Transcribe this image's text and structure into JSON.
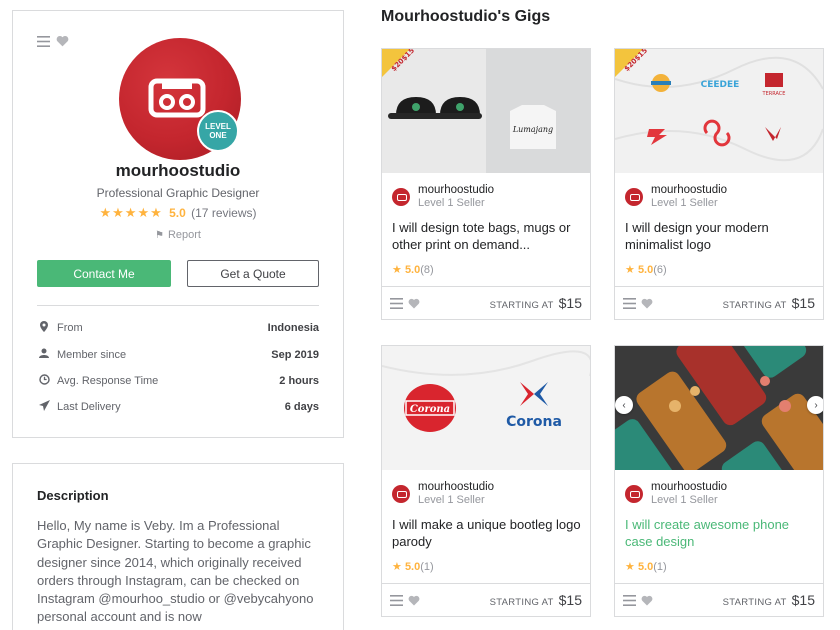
{
  "profile": {
    "username": "mourhoostudio",
    "level_badge": "LEVEL ONE",
    "tagline": "Professional Graphic Designer",
    "rating_stars": "★★★★★",
    "rating_score": "5.0",
    "rating_reviews": "(17 reviews)",
    "report_label": "Report",
    "contact_label": "Contact Me",
    "quote_label": "Get a Quote",
    "stats": [
      {
        "label": "From",
        "value": "Indonesia",
        "icon": "location-pin-icon"
      },
      {
        "label": "Member since",
        "value": "Sep 2019",
        "icon": "user-icon"
      },
      {
        "label": "Avg. Response Time",
        "value": "2 hours",
        "icon": "clock-icon"
      },
      {
        "label": "Last Delivery",
        "value": "6 days",
        "icon": "paper-plane-icon"
      }
    ]
  },
  "description": {
    "title": "Description",
    "body": "Hello, My name is Veby. Im a Professional Graphic Designer. Starting to become a graphic designer since 2014, which originally received orders through Instagram, can be checked on Instagram @mourhoo_studio or @vebycahyono personal account and is now"
  },
  "gigs_title": "Mourhoostudio's Gigs",
  "gigs": [
    {
      "seller": "mourhoostudio",
      "level": "Level 1 Seller",
      "title": "I will design tote bags, mugs or other print on demand...",
      "rating": "5.0",
      "count": "(8)",
      "price_label": "STARTING AT",
      "price": "$15",
      "promo": "$20$15"
    },
    {
      "seller": "mourhoostudio",
      "level": "Level 1 Seller",
      "title": "I will design your modern minimalist logo",
      "rating": "5.0",
      "count": "(6)",
      "price_label": "STARTING AT",
      "price": "$15",
      "promo": "$20$15"
    },
    {
      "seller": "mourhoostudio",
      "level": "Level 1 Seller",
      "title": "I will make a unique bootleg logo parody",
      "rating": "5.0",
      "count": "(1)",
      "price_label": "STARTING AT",
      "price": "$15",
      "image_text": {
        "left_logo": "Corona",
        "right_logo": "Corona"
      }
    },
    {
      "seller": "mourhoostudio",
      "level": "Level 1 Seller",
      "title": "I will create awesome phone case design",
      "rating": "5.0",
      "count": "(1)",
      "price_label": "STARTING AT",
      "price": "$15"
    }
  ],
  "gig2_logos": [
    "CEEDEE",
    "TERRACE"
  ],
  "colors": {
    "accent_green": "#4ab877",
    "brand_red": "#c4262e",
    "star": "#ffb33e",
    "level_teal": "#36a6a6"
  }
}
